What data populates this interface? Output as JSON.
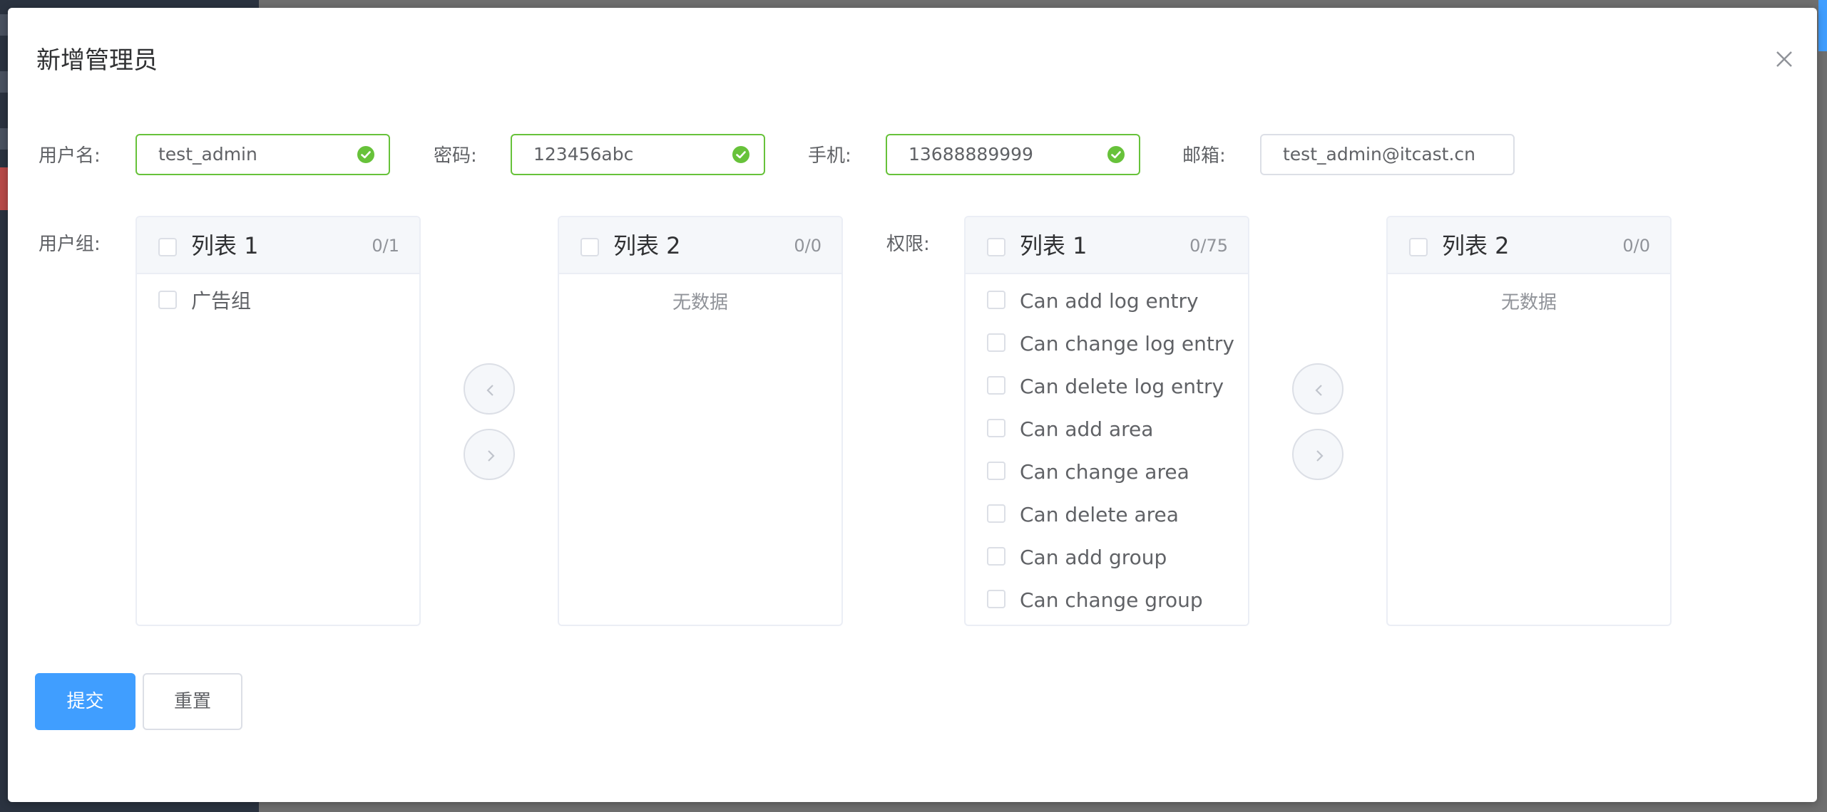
{
  "dialog": {
    "title": "新增管理员"
  },
  "form": {
    "username_label": "用户名:",
    "username_value": "test_admin",
    "password_label": "密码:",
    "password_value": "123456abc",
    "phone_label": "手机:",
    "phone_value": "13688889999",
    "email_label": "邮箱:",
    "email_value": "test_admin@itcast.cn",
    "group_label": "用户组:",
    "permission_label": "权限:"
  },
  "groups_transfer": {
    "left": {
      "title": "列表 1",
      "count": "0/1",
      "items": [
        "广告组"
      ]
    },
    "right": {
      "title": "列表 2",
      "count": "0/0",
      "empty_text": "无数据"
    }
  },
  "permissions_transfer": {
    "left": {
      "title": "列表 1",
      "count": "0/75",
      "items": [
        "Can add log entry",
        "Can change log entry",
        "Can delete log entry",
        "Can add area",
        "Can change area",
        "Can delete area",
        "Can add group",
        "Can change group"
      ]
    },
    "right": {
      "title": "列表 2",
      "count": "0/0",
      "empty_text": "无数据"
    }
  },
  "buttons": {
    "submit": "提交",
    "reset": "重置"
  },
  "icons": {
    "valid": "check-circle-icon",
    "close": "close-icon",
    "left": "chevron-left-icon",
    "right": "chevron-right-icon"
  },
  "colors": {
    "primary": "#409eff",
    "success": "#67c23a",
    "border": "#dcdfe6"
  }
}
